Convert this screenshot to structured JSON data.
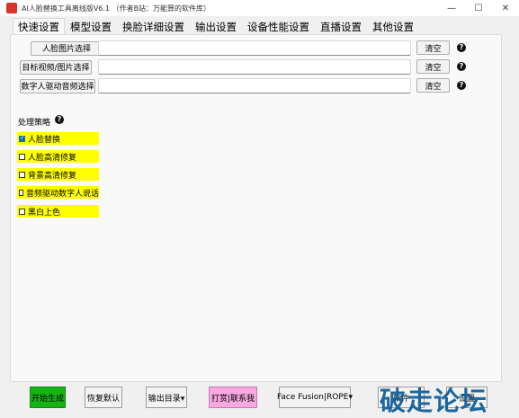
{
  "window": {
    "title": "AI人脸替换工具离线版V6.1 （作者B站：万能算的软件库）",
    "controls": {
      "minimize": "—",
      "maximize": "☐",
      "close": "✕"
    }
  },
  "tabs": [
    "快速设置",
    "模型设置",
    "换脸详细设置",
    "输出设置",
    "设备性能设置",
    "直播设置",
    "其他设置"
  ],
  "file_rows": [
    {
      "button": "人脸图片选择",
      "value": "",
      "clear": "清空",
      "help": "?"
    },
    {
      "button": "目标视频/图片选择",
      "value": "",
      "clear": "清空",
      "help": "?"
    },
    {
      "button": "数字人驱动音频选择",
      "value": "",
      "clear": "清空",
      "help": "?"
    }
  ],
  "strategy": {
    "label": "处理策略",
    "help": "?",
    "options": [
      {
        "label": "人脸替换",
        "checked": true
      },
      {
        "label": "人脸高清修复",
        "checked": false
      },
      {
        "label": "背景高清修复",
        "checked": false
      },
      {
        "label": "音频驱动数字人说话",
        "checked": false
      },
      {
        "label": "黑白上色",
        "checked": false
      }
    ]
  },
  "bottom": {
    "start": "开始生成",
    "reset": "恢复默认",
    "output_dir": "输出目录▾",
    "donate": "打赏|联系我",
    "engine": "Face Fusion|ROPE▾",
    "other": "软件",
    "other2": "设置"
  },
  "watermark": "破走论坛",
  "colors": {
    "highlight_yellow": "#ffff00",
    "start_button": "#16b316",
    "donate_button": "#f7a8e0",
    "watermark": "#0d5d99"
  }
}
